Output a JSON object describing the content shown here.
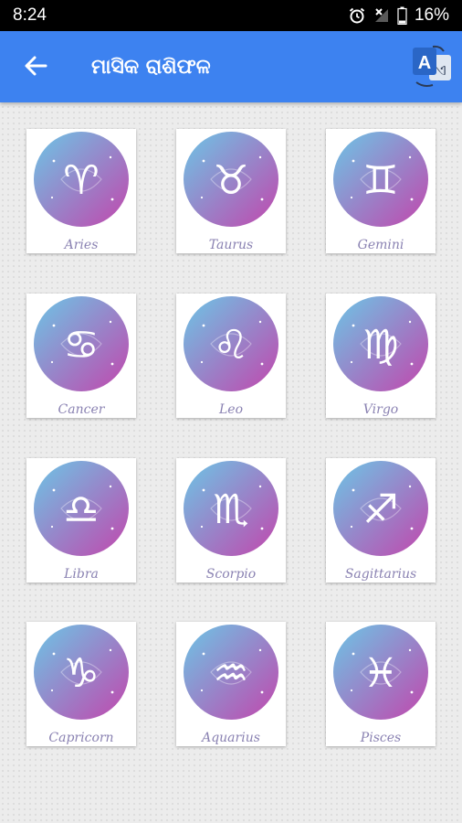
{
  "status_bar": {
    "time": "8:24",
    "battery": "16%",
    "icons": [
      "alarm-icon",
      "signal-off-icon",
      "battery-icon"
    ]
  },
  "app_bar": {
    "title": "ମାସିକ ରାଶିଫଳ",
    "back_icon": "arrow-left-icon",
    "translate_icon": "translate-icon",
    "translate_glyph_a": "A",
    "translate_glyph_b": "ଏ",
    "background": "#3d82f0"
  },
  "zodiac": {
    "gradient_start": "#6cc6e6",
    "gradient_end": "#c246ad",
    "signs": [
      {
        "name": "Aries",
        "symbol": "♈"
      },
      {
        "name": "Taurus",
        "symbol": "♉"
      },
      {
        "name": "Gemini",
        "symbol": "♊"
      },
      {
        "name": "Cancer",
        "symbol": "♋"
      },
      {
        "name": "Leo",
        "symbol": "♌"
      },
      {
        "name": "Virgo",
        "symbol": "♍"
      },
      {
        "name": "Libra",
        "symbol": "♎"
      },
      {
        "name": "Scorpio",
        "symbol": "♏"
      },
      {
        "name": "Sagittarius",
        "symbol": "♐"
      },
      {
        "name": "Capricorn",
        "symbol": "♑"
      },
      {
        "name": "Aquarius",
        "symbol": "♒"
      },
      {
        "name": "Pisces",
        "symbol": "♓"
      }
    ]
  }
}
